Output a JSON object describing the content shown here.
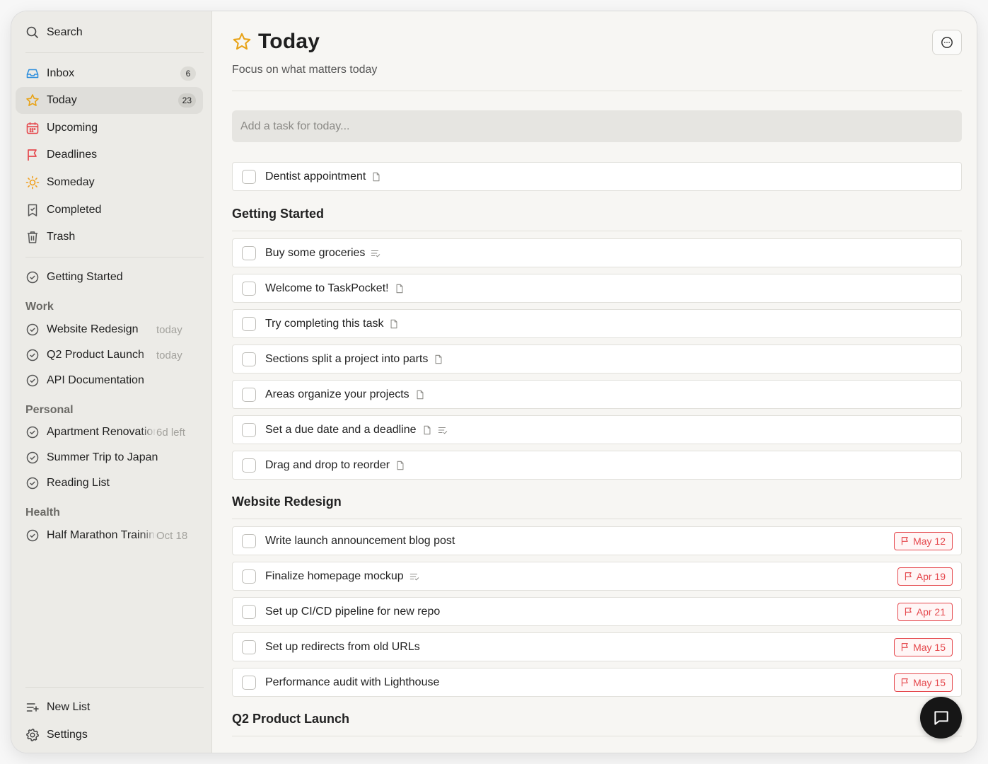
{
  "sidebar": {
    "search_label": "Search",
    "nav": [
      {
        "label": "Inbox",
        "icon": "inbox-icon",
        "badge": "6"
      },
      {
        "label": "Today",
        "icon": "star-icon",
        "badge": "23",
        "active": true
      },
      {
        "label": "Upcoming",
        "icon": "calendar-icon"
      },
      {
        "label": "Deadlines",
        "icon": "flag-icon"
      },
      {
        "label": "Someday",
        "icon": "sun-icon"
      },
      {
        "label": "Completed",
        "icon": "bookmark-check-icon"
      },
      {
        "label": "Trash",
        "icon": "trash-icon"
      }
    ],
    "getting_started": "Getting Started",
    "groups": [
      {
        "title": "Work",
        "items": [
          {
            "label": "Website Redesign",
            "meta": "today"
          },
          {
            "label": "Q2 Product Launch",
            "meta": "today"
          },
          {
            "label": "API Documentation",
            "meta": ""
          }
        ]
      },
      {
        "title": "Personal",
        "items": [
          {
            "label": "Apartment Renovation",
            "meta": "6d left"
          },
          {
            "label": "Summer Trip to Japan",
            "meta": ""
          },
          {
            "label": "Reading List",
            "meta": ""
          }
        ]
      },
      {
        "title": "Health",
        "items": [
          {
            "label": "Half Marathon Training",
            "meta": "Oct 18"
          }
        ]
      }
    ],
    "new_list_label": "New List",
    "settings_label": "Settings"
  },
  "main": {
    "title": "Today",
    "subtitle": "Focus on what matters today",
    "add_placeholder": "Add a task for today...",
    "loose_tasks": [
      {
        "label": "Dentist appointment",
        "icons": [
          "note-icon"
        ]
      }
    ],
    "sections": [
      {
        "title": "Getting Started",
        "tasks": [
          {
            "label": "Buy some groceries",
            "icons": [
              "checklist-icon"
            ]
          },
          {
            "label": "Welcome to TaskPocket!",
            "icons": [
              "note-icon"
            ]
          },
          {
            "label": "Try completing this task",
            "icons": [
              "note-icon"
            ]
          },
          {
            "label": "Sections split a project into parts",
            "icons": [
              "note-icon"
            ]
          },
          {
            "label": "Areas organize your projects",
            "icons": [
              "note-icon"
            ]
          },
          {
            "label": "Set a due date and a deadline",
            "icons": [
              "note-icon",
              "checklist-icon"
            ]
          },
          {
            "label": "Drag and drop to reorder",
            "icons": [
              "note-icon"
            ]
          }
        ]
      },
      {
        "title": "Website Redesign",
        "tasks": [
          {
            "label": "Write launch announcement blog post",
            "icons": [],
            "deadline": "May 12"
          },
          {
            "label": "Finalize homepage mockup",
            "icons": [
              "checklist-icon"
            ],
            "deadline": "Apr 19"
          },
          {
            "label": "Set up CI/CD pipeline for new repo",
            "icons": [],
            "deadline": "Apr 21"
          },
          {
            "label": "Set up redirects from old URLs",
            "icons": [],
            "deadline": "May 15"
          },
          {
            "label": "Performance audit with Lighthouse",
            "icons": [],
            "deadline": "May 15"
          }
        ]
      },
      {
        "title": "Q2 Product Launch",
        "tasks": []
      }
    ]
  },
  "colors": {
    "accent_star": "#e8a317",
    "deadline_red": "#e5484d",
    "inbox_blue": "#2f8fdd",
    "calendar_red": "#e5484d",
    "sun_orange": "#f0a020"
  }
}
